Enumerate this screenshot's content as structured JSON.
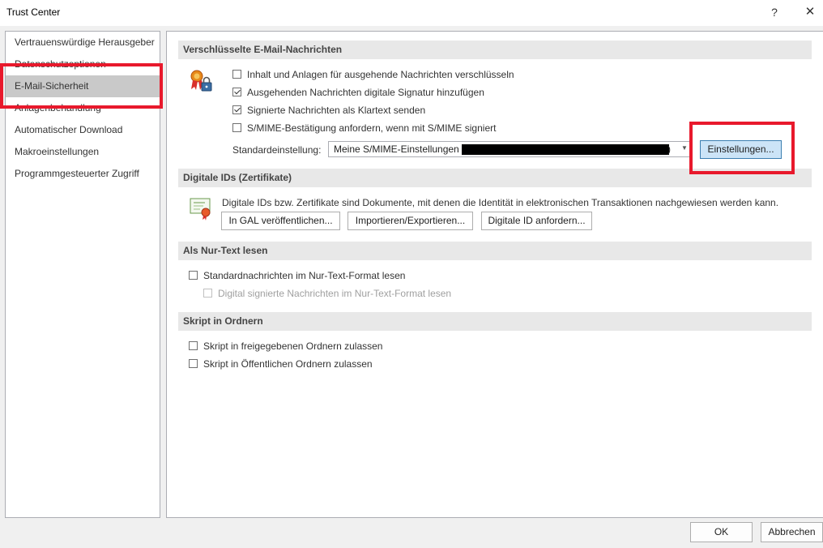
{
  "window": {
    "title": "Trust Center",
    "help_label": "?",
    "close_label": "✕"
  },
  "sidebar": {
    "items": [
      {
        "label": "Vertrauenswürdige Herausgeber"
      },
      {
        "label": "Datenschutzoptionen"
      },
      {
        "label": "E-Mail-Sicherheit",
        "selected": true
      },
      {
        "label": "Anlagenbehandlung"
      },
      {
        "label": "Automatischer Download"
      },
      {
        "label": "Makroeinstellungen"
      },
      {
        "label": "Programmgesteuerter Zugriff"
      }
    ]
  },
  "encrypted": {
    "header": "Verschlüsselte E-Mail-Nachrichten",
    "options": [
      {
        "label": "Inhalt und Anlagen für ausgehende Nachrichten verschlüsseln",
        "checked": false
      },
      {
        "label": "Ausgehenden Nachrichten digitale Signatur hinzufügen",
        "checked": true
      },
      {
        "label": "Signierte Nachrichten als Klartext senden",
        "checked": true
      },
      {
        "label": "S/MIME-Bestätigung anfordern, wenn mit S/MIME signiert",
        "checked": false
      }
    ],
    "default_label": "Standardeinstellung:",
    "default_value": "Meine S/MIME-Einstellungen",
    "default_value_tail": ")",
    "settings_button": "Einstellungen..."
  },
  "digital_ids": {
    "header": "Digitale IDs (Zertifikate)",
    "description": "Digitale IDs bzw. Zertifikate sind Dokumente, mit denen die Identität in elektronischen Transaktionen nachgewiesen werden kann.",
    "buttons": [
      "In GAL veröffentlichen...",
      "Importieren/Exportieren...",
      "Digitale ID anfordern..."
    ]
  },
  "plain_text": {
    "header": "Als Nur-Text lesen",
    "options": [
      {
        "label": "Standardnachrichten im Nur-Text-Format lesen",
        "checked": false,
        "disabled": false
      },
      {
        "label": "Digital signierte Nachrichten im Nur-Text-Format lesen",
        "checked": false,
        "disabled": true
      }
    ]
  },
  "script": {
    "header": "Skript in Ordnern",
    "options": [
      {
        "label": "Skript in freigegebenen Ordnern zulassen",
        "checked": false
      },
      {
        "label": "Skript in Öffentlichen Ordnern zulassen",
        "checked": false
      }
    ]
  },
  "footer": {
    "ok": "OK",
    "cancel": "Abbrechen"
  },
  "colors": {
    "highlight_box": "#e8192c",
    "selected_nav": "#c9c9c9",
    "section_header_bg": "#e8e8e8",
    "primary_button_bg": "#cce4f7"
  }
}
